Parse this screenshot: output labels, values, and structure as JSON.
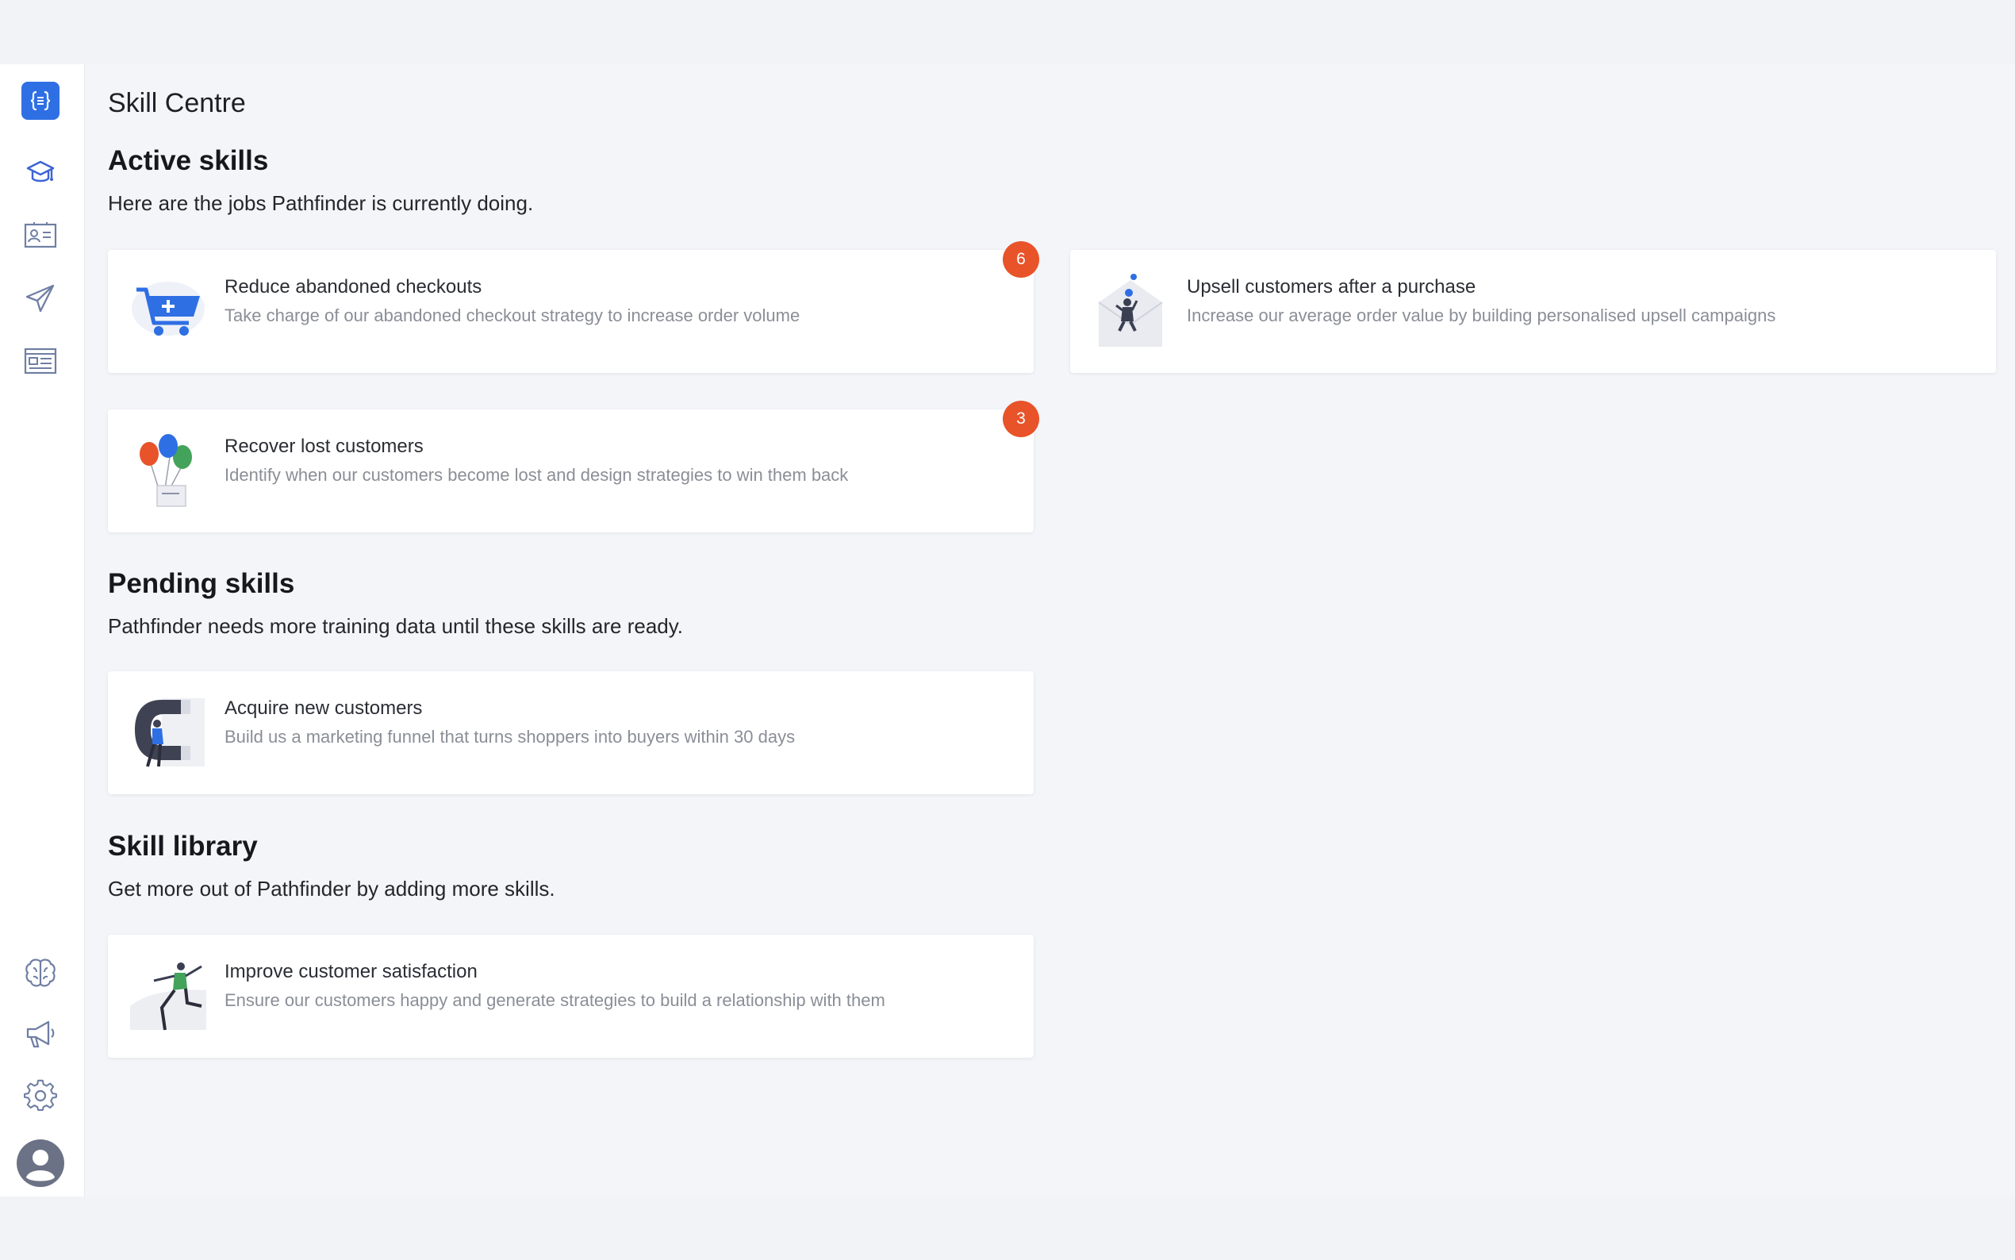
{
  "page": {
    "title": "Skill Centre"
  },
  "sidebar": {
    "top_items": [
      {
        "icon": "graduation-cap-icon"
      },
      {
        "icon": "contact-card-icon"
      },
      {
        "icon": "paper-plane-icon"
      },
      {
        "icon": "newspaper-icon"
      }
    ],
    "bottom_items": [
      {
        "icon": "brain-icon"
      },
      {
        "icon": "megaphone-icon"
      },
      {
        "icon": "gear-icon"
      },
      {
        "icon": "user-avatar-icon"
      }
    ],
    "logo_icon": "braces-logo-icon"
  },
  "sections": {
    "active": {
      "title": "Active skills",
      "subtitle": "Here are the jobs Pathfinder is currently doing.",
      "cards": [
        {
          "title": "Reduce abandoned checkouts",
          "description": "Take charge of our abandoned checkout strategy to increase order volume",
          "badge": "6",
          "illustration": "shopping-cart-icon"
        },
        {
          "title": "Upsell customers after a purchase",
          "description": "Increase our average order value by building personalised upsell campaigns",
          "illustration": "envelope-person-icon"
        },
        {
          "title": "Recover lost customers",
          "description": "Identify when our customers become lost and design strategies to win them back",
          "badge": "3",
          "illustration": "balloons-icon"
        }
      ]
    },
    "pending": {
      "title": "Pending skills",
      "subtitle": "Pathfinder needs more training data until these skills are ready.",
      "cards": [
        {
          "title": "Acquire new customers",
          "description": "Build us a marketing funnel that turns shoppers into buyers within 30 days",
          "illustration": "magnet-person-icon"
        }
      ]
    },
    "library": {
      "title": "Skill library",
      "subtitle": "Get more out of Pathfinder by adding more skills.",
      "cards": [
        {
          "title": "Improve customer satisfaction",
          "description": "Ensure our customers happy and generate strategies to build a relationship with them",
          "illustration": "jumping-person-icon"
        }
      ]
    }
  },
  "colors": {
    "accent": "#2f6fe4",
    "badge": "#e8532a",
    "icon_stroke": "#6f7fa3"
  }
}
